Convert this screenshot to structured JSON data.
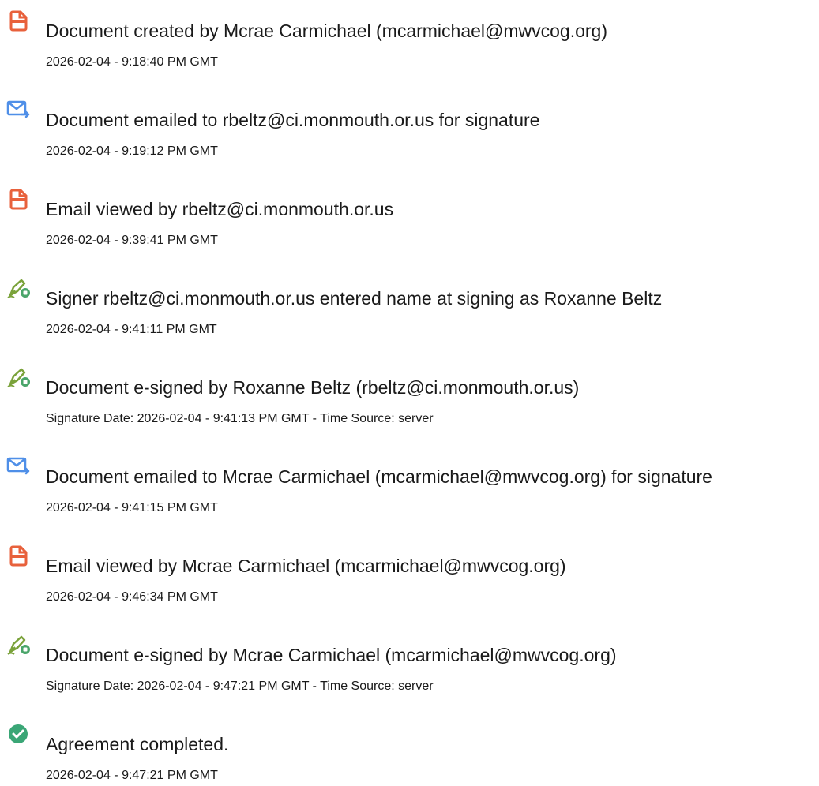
{
  "colors": {
    "document_icon": "#e8613c",
    "email_icon": "#4f8fe8",
    "sign_icon_pen": "#7aa23a",
    "sign_icon_badge": "#4aa56a",
    "complete_icon": "#3aa676",
    "text": "#1a1a1a"
  },
  "events": [
    {
      "icon": "document-icon",
      "title": "Document created by Mcrae Carmichael (mcarmichael@mwvcog.org)",
      "detail": "2026-02-04 - 9:18:40 PM GMT"
    },
    {
      "icon": "email-sent-icon",
      "title": "Document emailed to rbeltz@ci.monmouth.or.us for signature",
      "detail": "2026-02-04 - 9:19:12 PM GMT"
    },
    {
      "icon": "document-icon",
      "title": "Email viewed by rbeltz@ci.monmouth.or.us",
      "detail": "2026-02-04 - 9:39:41 PM GMT"
    },
    {
      "icon": "e-sign-pen-icon",
      "title": "Signer rbeltz@ci.monmouth.or.us entered name at signing as Roxanne Beltz",
      "detail": "2026-02-04 - 9:41:11 PM GMT"
    },
    {
      "icon": "e-sign-pen-icon",
      "title": "Document e-signed by Roxanne Beltz (rbeltz@ci.monmouth.or.us)",
      "detail": "Signature Date: 2026-02-04 - 9:41:13 PM GMT - Time Source: server"
    },
    {
      "icon": "email-sent-icon",
      "title": "Document emailed to Mcrae Carmichael (mcarmichael@mwvcog.org) for signature",
      "detail": "2026-02-04 - 9:41:15 PM GMT"
    },
    {
      "icon": "document-icon",
      "title": "Email viewed by Mcrae Carmichael (mcarmichael@mwvcog.org)",
      "detail": "2026-02-04 - 9:46:34 PM GMT"
    },
    {
      "icon": "e-sign-pen-icon",
      "title": "Document e-signed by Mcrae Carmichael (mcarmichael@mwvcog.org)",
      "detail": "Signature Date: 2026-02-04 - 9:47:21 PM GMT - Time Source: server"
    },
    {
      "icon": "checkmark-circle-icon",
      "title": "Agreement completed.",
      "detail": "2026-02-04 - 9:47:21 PM GMT"
    }
  ]
}
